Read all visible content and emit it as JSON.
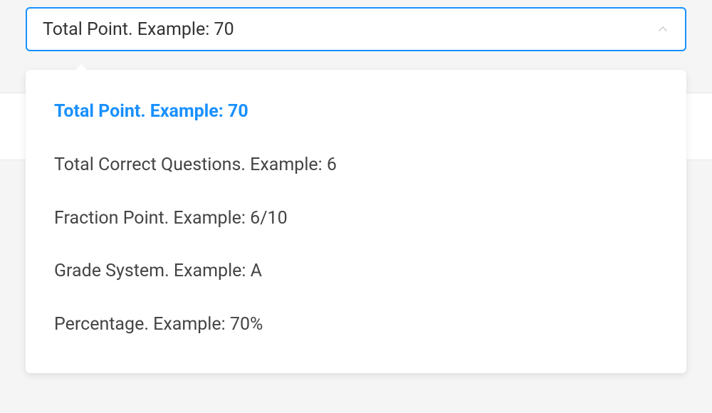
{
  "select": {
    "selected_value": "Total Point. Example: 70",
    "options": [
      {
        "label": "Total Point. Example: 70",
        "selected": true
      },
      {
        "label": "Total Correct Questions. Example: 6",
        "selected": false
      },
      {
        "label": "Fraction Point. Example: 6/10",
        "selected": false
      },
      {
        "label": "Grade System. Example: A",
        "selected": false
      },
      {
        "label": "Percentage. Example: 70%",
        "selected": false
      }
    ]
  }
}
